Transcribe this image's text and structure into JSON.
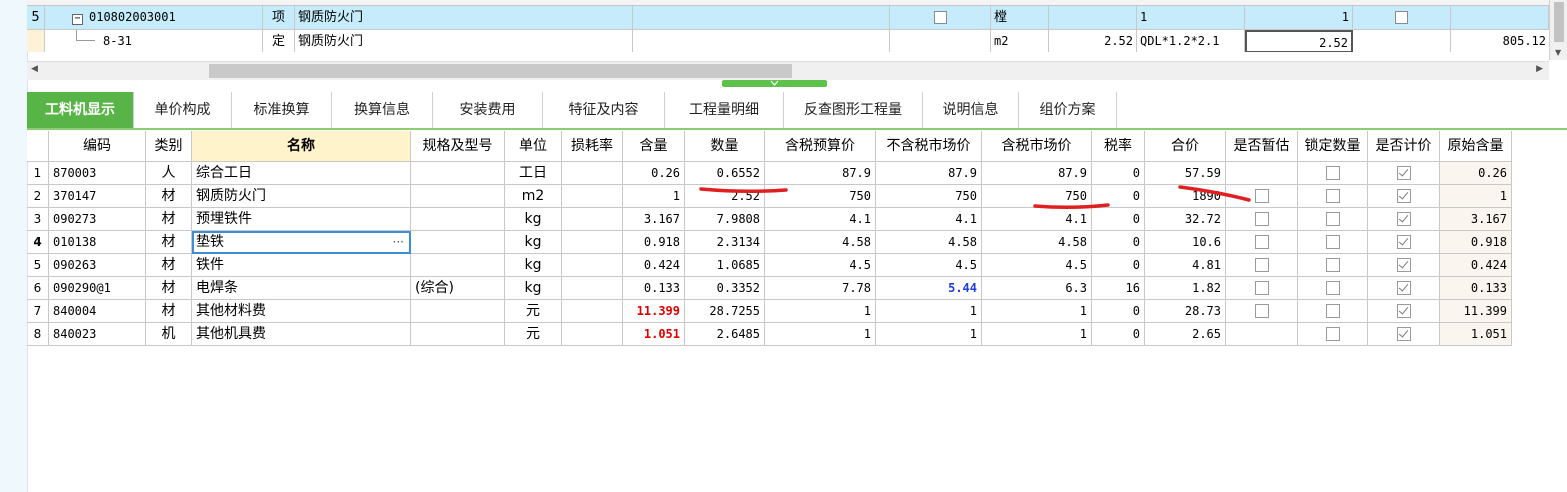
{
  "top_grid": {
    "rows": [
      {
        "index": "5",
        "expand_icon": "minus",
        "code": "010802003001",
        "type": "项",
        "name": "钢质防火门",
        "unit": "樘",
        "expr": "1",
        "qty": "1"
      },
      {
        "index": "",
        "code": "8-31",
        "type": "定",
        "name": "钢质防火门",
        "unit": "m2",
        "content": "2.52",
        "expr": "QDL*1.2*2.1",
        "qty": "2.52",
        "total": "805.12"
      }
    ]
  },
  "tabs": [
    {
      "label": "工料机显示",
      "active": true
    },
    {
      "label": "单价构成"
    },
    {
      "label": "标准换算"
    },
    {
      "label": "换算信息"
    },
    {
      "label": "安装费用"
    },
    {
      "label": "特征及内容"
    },
    {
      "label": "工程量明细"
    },
    {
      "label": "反查图形工程量"
    },
    {
      "label": "说明信息"
    },
    {
      "label": "组价方案"
    }
  ],
  "grid": {
    "headers": [
      "编码",
      "类别",
      "名称",
      "规格及型号",
      "单位",
      "损耗率",
      "含量",
      "数量",
      "含税预算价",
      "不含税市场价",
      "含税市场价",
      "税率",
      "合价",
      "是否暂估",
      "锁定数量",
      "是否计价",
      "原始含量"
    ],
    "rows": [
      {
        "no": "1",
        "code": "870003",
        "cat": "人",
        "name": "综合工日",
        "spec": "",
        "unit": "工日",
        "loss": "",
        "content": "0.26",
        "qty": "0.6552",
        "tax_budget": "87.9",
        "notax_market": "87.9",
        "tax_market": "87.9",
        "rate": "0",
        "total": "57.59",
        "provisional": null,
        "locked": false,
        "priced": true,
        "orig": "0.26"
      },
      {
        "no": "2",
        "code": "370147",
        "cat": "材",
        "name": "钢质防火门",
        "spec": "",
        "unit": "m2",
        "loss": "",
        "content": "1",
        "qty": "2.52",
        "tax_budget": "750",
        "notax_market": "750",
        "tax_market": "750",
        "rate": "0",
        "total": "1890",
        "provisional": false,
        "locked": false,
        "priced": true,
        "orig": "1"
      },
      {
        "no": "3",
        "code": "090273",
        "cat": "材",
        "name": "预埋铁件",
        "spec": "",
        "unit": "kg",
        "loss": "",
        "content": "3.167",
        "qty": "7.9808",
        "tax_budget": "4.1",
        "notax_market": "4.1",
        "tax_market": "4.1",
        "rate": "0",
        "total": "32.72",
        "provisional": false,
        "locked": false,
        "priced": true,
        "orig": "3.167"
      },
      {
        "no": "4",
        "code": "010138",
        "cat": "材",
        "name": "垫铁",
        "spec": "",
        "unit": "kg",
        "loss": "",
        "content": "0.918",
        "qty": "2.3134",
        "tax_budget": "4.58",
        "notax_market": "4.58",
        "tax_market": "4.58",
        "rate": "0",
        "total": "10.6",
        "provisional": false,
        "locked": false,
        "priced": true,
        "orig": "0.918",
        "current": true
      },
      {
        "no": "5",
        "code": "090263",
        "cat": "材",
        "name": "铁件",
        "spec": "",
        "unit": "kg",
        "loss": "",
        "content": "0.424",
        "qty": "1.0685",
        "tax_budget": "4.5",
        "notax_market": "4.5",
        "tax_market": "4.5",
        "rate": "0",
        "total": "4.81",
        "provisional": false,
        "locked": false,
        "priced": true,
        "orig": "0.424"
      },
      {
        "no": "6",
        "code": "090290@1",
        "cat": "材",
        "name": "电焊条",
        "spec": "(综合)",
        "unit": "kg",
        "loss": "",
        "content": "0.133",
        "qty": "0.3352",
        "tax_budget": "7.78",
        "notax_market": "5.44",
        "tax_market": "6.3",
        "rate": "16",
        "total": "1.82",
        "provisional": false,
        "locked": false,
        "priced": true,
        "orig": "0.133",
        "notax_blue": true
      },
      {
        "no": "7",
        "code": "840004",
        "cat": "材",
        "name": "其他材料费",
        "spec": "",
        "unit": "元",
        "loss": "",
        "content": "11.399",
        "qty": "28.7255",
        "tax_budget": "1",
        "notax_market": "1",
        "tax_market": "1",
        "rate": "0",
        "total": "28.73",
        "provisional": false,
        "locked": false,
        "priced": true,
        "orig": "11.399",
        "content_red": true
      },
      {
        "no": "8",
        "code": "840023",
        "cat": "机",
        "name": "其他机具费",
        "spec": "",
        "unit": "元",
        "loss": "",
        "content": "1.051",
        "qty": "2.6485",
        "tax_budget": "1",
        "notax_market": "1",
        "tax_market": "1",
        "rate": "0",
        "total": "2.65",
        "provisional": null,
        "locked": false,
        "priced": true,
        "orig": "1.051",
        "content_red": true
      }
    ]
  },
  "ui": {
    "ellipsis": "···",
    "scroll_left": "◀",
    "scroll_right": "▶",
    "scroll_down": "▼",
    "splitter_icon": "chevron-down-icon"
  },
  "colors": {
    "tab_active": "#58b447",
    "selected_row": "#c6ecfb",
    "name_header": "#fff3cc",
    "annotation_red": "#e02020",
    "value_red": "#e00000",
    "value_blue": "#1f3fd6"
  }
}
